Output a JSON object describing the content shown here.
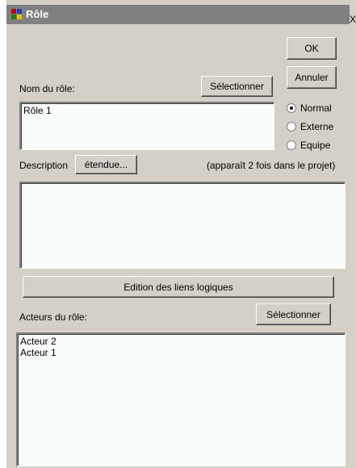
{
  "window": {
    "title": "Rôle",
    "close_glyph": "X"
  },
  "buttons": {
    "ok": "OK",
    "cancel": "Annuler",
    "select_name": "Sélectionner",
    "extended_description": "étendue...",
    "logical_links": "Edition des liens logiques",
    "select_actors": "Sélectionner"
  },
  "role_name": {
    "label": "Nom du rôle:",
    "value": "Rôle 1"
  },
  "role_type": {
    "selected": "Normal",
    "options": [
      "Normal",
      "Externe",
      "Equipe"
    ]
  },
  "description": {
    "label": "Description",
    "note": "(apparaît 2 fois dans le projet)",
    "value": ""
  },
  "actors": {
    "label": "Acteurs du rôle:",
    "items": [
      "Acteur 2",
      "Acteur 1"
    ]
  }
}
